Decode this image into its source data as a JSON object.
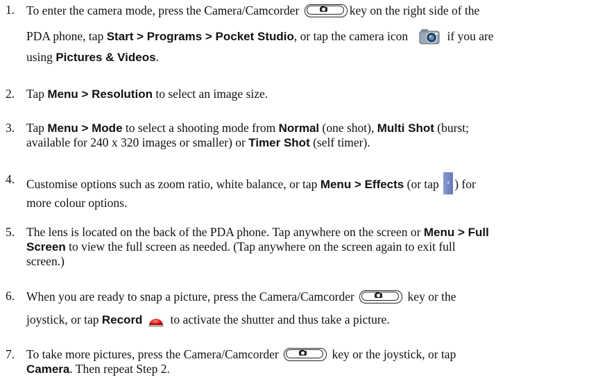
{
  "steps": [
    {
      "num": "1.",
      "lines": [
        [
          "To enter the camera mode, press the Camera/Camcorder ",
          "key on the right side of the"
        ],
        [
          "PDA phone, tap ",
          "Start > Programs > Pocket Studio",
          ", or tap the camera icon ",
          "if you are"
        ],
        [
          "using ",
          "Pictures & Videos",
          "."
        ]
      ]
    },
    {
      "num": "2.",
      "lines": [
        [
          "Tap ",
          "Menu > Resolution",
          " to select an image size."
        ]
      ]
    },
    {
      "num": "3.",
      "lines": [
        [
          "Tap ",
          "Menu > Mode",
          " to select a shooting mode from ",
          "Normal",
          " (one shot), ",
          "Multi Shot",
          " (burst;"
        ],
        [
          "available for 240 x 320 images or smaller) or ",
          "Timer Shot",
          " (self timer)."
        ]
      ]
    },
    {
      "num": "4.",
      "lines": [
        [
          "Customise options such as zoom ratio, white balance, or tap ",
          "Menu > Effects",
          " (or tap ",
          ") for"
        ],
        [
          "more colour options."
        ]
      ]
    },
    {
      "num": "5.",
      "lines": [
        [
          "The lens is located on the back of the PDA phone. Tap anywhere on the screen or ",
          "Menu > Full"
        ],
        [
          "Screen",
          " to view the full screen as needed. (Tap anywhere on the screen again to exit full"
        ],
        [
          "screen.)"
        ]
      ]
    },
    {
      "num": "6.",
      "lines": [
        [
          "When you are ready to snap a picture, press the Camera/Camcorder ",
          " key or the"
        ],
        [
          "joystick, or tap ",
          "Record",
          "to activate the shutter and thus take a picture."
        ]
      ]
    },
    {
      "num": "7.",
      "lines": [
        [
          "To take more pictures, press the Camera/Camcorder ",
          " key or the joystick, or tap"
        ],
        [
          "Camera",
          ". Then repeat Step 2."
        ]
      ]
    }
  ],
  "icons": {
    "camera_key": "camera-key-icon",
    "camera_app": "camera-icon",
    "effects_tab": "effects-tab-icon",
    "record": "record-icon"
  }
}
